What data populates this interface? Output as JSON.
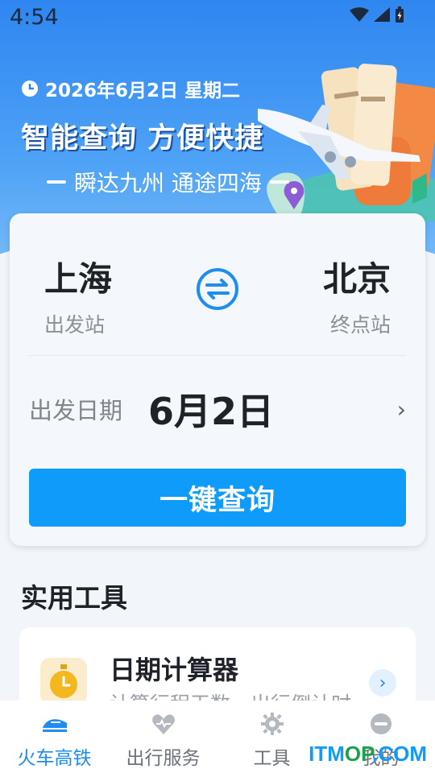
{
  "status_bar": {
    "time": "4:54"
  },
  "header": {
    "date": "2026年6月2日 星期二",
    "slogan": "智能查询 方便快捷",
    "sub_slogan": "瞬达九州 通途四海"
  },
  "search": {
    "from": {
      "name": "上海",
      "label": "出发站"
    },
    "to": {
      "name": "北京",
      "label": "终点站"
    },
    "date_label": "出发日期",
    "date_value": "6月2日",
    "button": "一键查询"
  },
  "tools": {
    "title": "实用工具",
    "items": [
      {
        "name": "日期计算器",
        "desc": "计算行程天数，出行倒计时"
      }
    ]
  },
  "nav": {
    "items": [
      {
        "label": "火车高铁",
        "icon": "train-icon",
        "active": true
      },
      {
        "label": "出行服务",
        "icon": "heart-service-icon",
        "active": false
      },
      {
        "label": "工具",
        "icon": "gear-icon",
        "active": false
      },
      {
        "label": "我的",
        "icon": "user-icon",
        "active": false
      }
    ]
  },
  "watermark": {
    "text_blue": "ITM",
    "text_green": "OP",
    "text_blue2": ".COM"
  },
  "colors": {
    "primary": "#0f9bfa",
    "hero": "#2f86f0",
    "accent": "#1f8cf0"
  }
}
